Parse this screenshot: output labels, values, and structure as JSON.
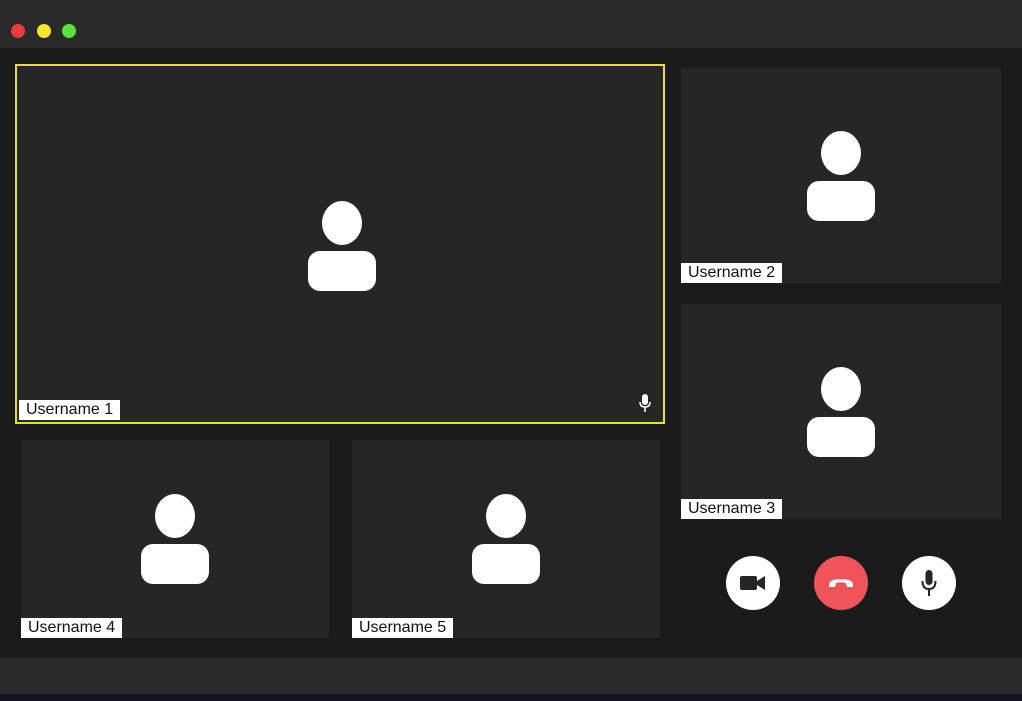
{
  "window": {
    "controls": [
      "close",
      "minimize",
      "maximize"
    ],
    "colors": {
      "close": "#ef3b3b",
      "minimize": "#f6e52a",
      "maximize": "#5ee03b"
    }
  },
  "participants": [
    {
      "name": "Username 1",
      "active": true,
      "mic_icon": "mic-icon"
    },
    {
      "name": "Username 2"
    },
    {
      "name": "Username 3"
    },
    {
      "name": "Username 4"
    },
    {
      "name": "Username 5"
    }
  ],
  "controls": [
    {
      "icon": "video-camera-icon"
    },
    {
      "icon": "phone-hangup-icon"
    },
    {
      "icon": "microphone-icon"
    }
  ],
  "colors": {
    "active_border": "#e2de3e",
    "hangup": "#f0545a",
    "tile_bg": "#262626"
  }
}
